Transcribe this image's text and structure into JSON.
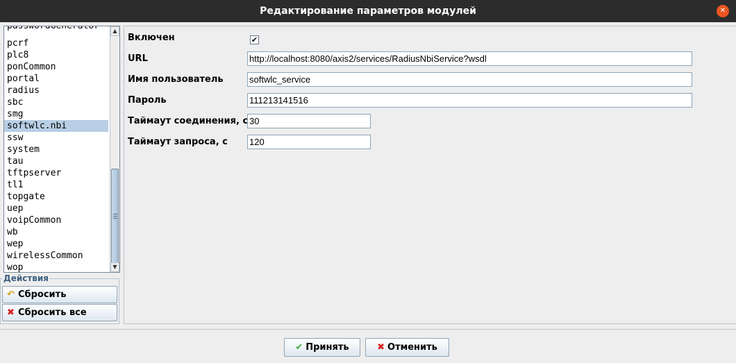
{
  "window": {
    "title": "Редактирование параметров модулей",
    "close_icon": "close-icon"
  },
  "module_list": {
    "partial_top_item": "passwordGenerator",
    "items": [
      "pcrf",
      "plc8",
      "ponCommon",
      "portal",
      "radius",
      "sbc",
      "smg",
      "softwlc.nbi",
      "ssw",
      "system",
      "tau",
      "tftpserver",
      "tl1",
      "topgate",
      "uep",
      "voipCommon",
      "wb",
      "wep",
      "wirelessCommon",
      "wop"
    ],
    "selected": "softwlc.nbi"
  },
  "actions": {
    "legend": "Действия",
    "reset_label": "Сбросить",
    "reset_all_label": "Сбросить все"
  },
  "form": {
    "enabled": {
      "label": "Включен",
      "checked": "✔"
    },
    "url": {
      "label": "URL",
      "value": "http://localhost:8080/axis2/services/RadiusNbiService?wsdl"
    },
    "username": {
      "label": "Имя пользователь",
      "value": "softwlc_service"
    },
    "password": {
      "label": "Пароль",
      "value": "111213141516"
    },
    "connect_timeout": {
      "label": "Таймаут соединения, с",
      "value": "30"
    },
    "request_timeout": {
      "label": "Таймаут запроса, с",
      "value": "120"
    }
  },
  "footer": {
    "accept_label": "Принять",
    "cancel_label": "Отменить"
  },
  "colors": {
    "titlebar": "#2c2c2c",
    "selection": "#b8cfe5",
    "accept_icon": "#3cae3c",
    "cancel_icon": "#d62020"
  }
}
